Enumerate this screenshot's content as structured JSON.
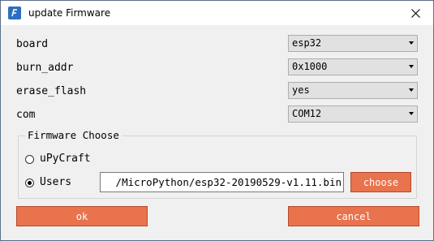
{
  "window": {
    "title": "update Firmware",
    "close_glyph": "✕"
  },
  "settings": [
    {
      "label": "board",
      "value": "esp32"
    },
    {
      "label": "burn_addr",
      "value": "0x1000"
    },
    {
      "label": "erase_flash",
      "value": "yes"
    },
    {
      "label": "com",
      "value": "COM12"
    }
  ],
  "firmware_choose": {
    "title": "Firmware Choose",
    "options": [
      {
        "label": "uPyCraft",
        "selected": false
      },
      {
        "label": "Users",
        "selected": true
      }
    ],
    "path_value": "/MicroPython/esp32-20190529-v1.11.bin",
    "choose_label": "choose"
  },
  "actions": {
    "ok_label": "ok",
    "cancel_label": "cancel"
  },
  "colors": {
    "accent": "#e8734d",
    "app_icon": "#2c6fbf"
  }
}
